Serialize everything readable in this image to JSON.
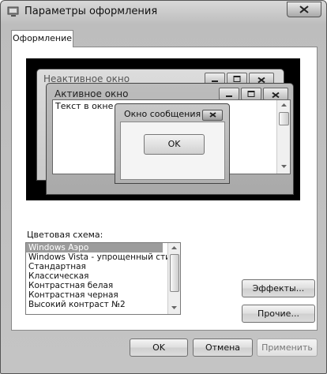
{
  "window": {
    "title": "Параметры оформления"
  },
  "tabs": [
    {
      "label": "Оформление"
    }
  ],
  "preview": {
    "inactive_title": "Неактивное окно",
    "active_title": "Активное окно",
    "window_text": "Текст в окне",
    "message_title": "Окно сообщения",
    "message_ok": "OK"
  },
  "color_scheme": {
    "label": "Цветовая схема:",
    "items": [
      "Windows Аэро",
      "Windows Vista - упрощенный стиль",
      "Стандартная",
      "Классическая",
      "Контрастная белая",
      "Контрастная черная",
      "Высокий контраст №2"
    ],
    "selected": "Windows Аэро"
  },
  "buttons": {
    "effects": "Эффекты...",
    "other": "Прочие...",
    "ok": "OK",
    "cancel": "Отмена",
    "apply": "Применить"
  }
}
